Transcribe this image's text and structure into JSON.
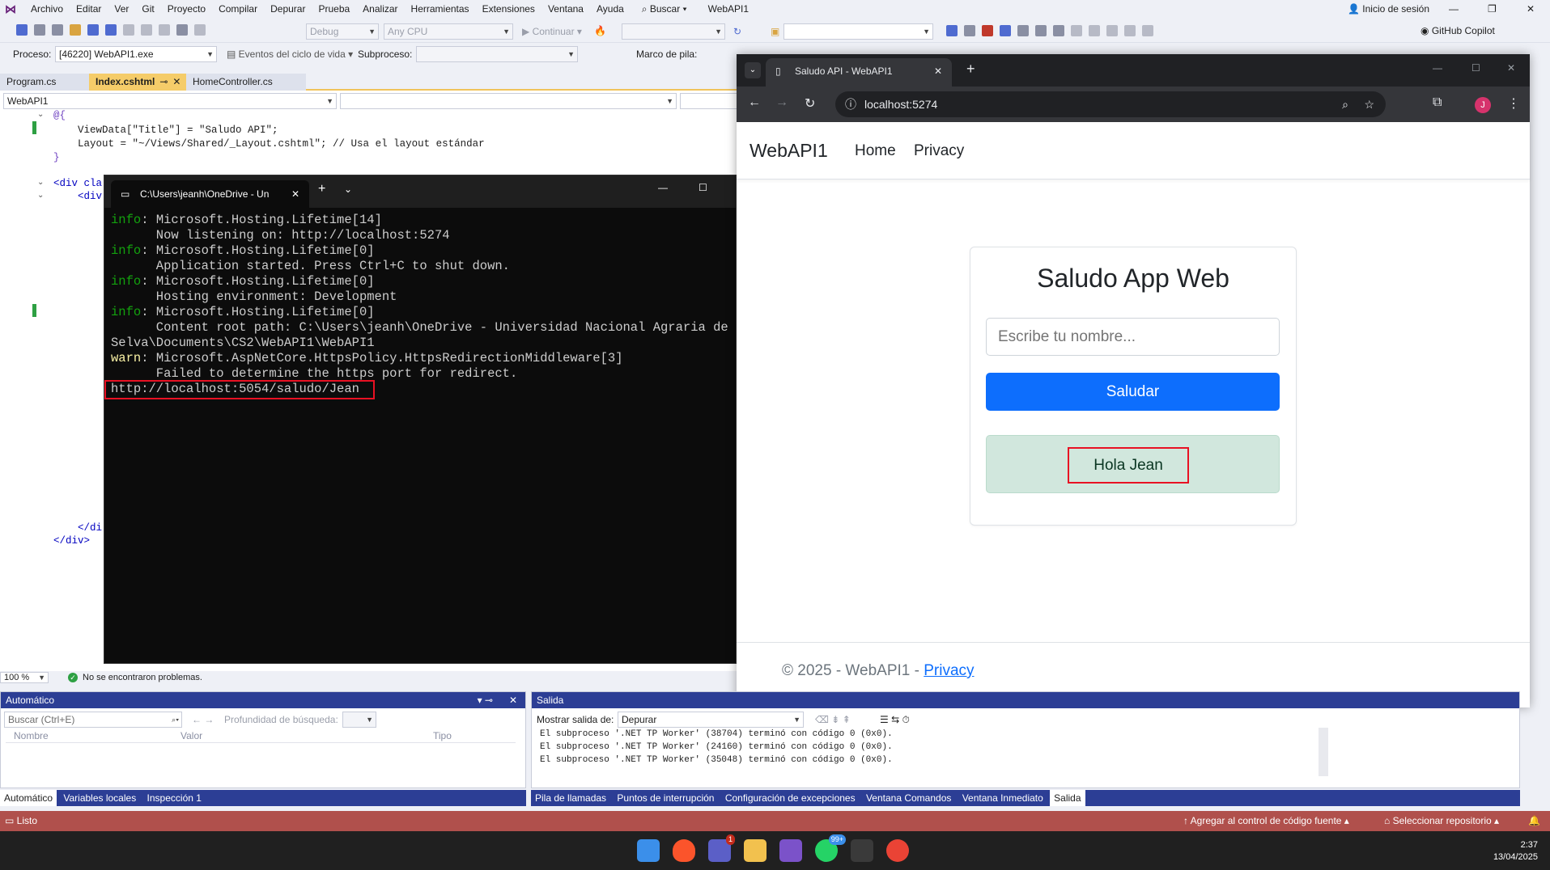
{
  "vs": {
    "menu": [
      "Archivo",
      "Editar",
      "Ver",
      "Git",
      "Proyecto",
      "Compilar",
      "Depurar",
      "Prueba",
      "Analizar",
      "Herramientas",
      "Extensiones",
      "Ventana",
      "Ayuda"
    ],
    "search_label": "Buscar",
    "solution_name": "WebAPI1",
    "signin": "Inicio de sesión",
    "config": "Debug",
    "platform": "Any CPU",
    "continue_label": "Continuar",
    "copilot": "GitHub Copilot",
    "process_label": "Proceso:",
    "process_value": "[46220] WebAPI1.exe",
    "lifecycle_label": "Eventos del ciclo de vida",
    "thread_label": "Subproceso:",
    "stackframe_label": "Marco de pila:",
    "tabs": [
      "Program.cs",
      "Index.cshtml",
      "HomeController.cs"
    ],
    "nav_project": "WebAPI1",
    "code": [
      "@{",
      "    ViewData[\"Title\"] = \"Saludo API\";",
      "    Layout = \"~/Views/Shared/_Layout.cshtml\"; // Usa el layout estándar",
      "}",
      "<div cla",
      "    <div",
      "    </di",
      "</div>"
    ],
    "zoom": "100 %",
    "issues": "No se encontraron problemas."
  },
  "terminal": {
    "tab_title": "C:\\Users\\jeanh\\OneDrive - Un",
    "lines": [
      {
        "tag": "info",
        "text": ": Microsoft.Hosting.Lifetime[14]"
      },
      {
        "tag": "",
        "text": "      Now listening on: http://localhost:5274"
      },
      {
        "tag": "info",
        "text": ": Microsoft.Hosting.Lifetime[0]"
      },
      {
        "tag": "",
        "text": "      Application started. Press Ctrl+C to shut down."
      },
      {
        "tag": "info",
        "text": ": Microsoft.Hosting.Lifetime[0]"
      },
      {
        "tag": "",
        "text": "      Hosting environment: Development"
      },
      {
        "tag": "info",
        "text": ": Microsoft.Hosting.Lifetime[0]"
      },
      {
        "tag": "",
        "text": "      Content root path: C:\\Users\\jeanh\\OneDrive - Universidad Nacional Agraria de la"
      },
      {
        "tag": "",
        "text": "Selva\\Documents\\CS2\\WebAPI1\\WebAPI1"
      },
      {
        "tag": "warn",
        "text": ": Microsoft.AspNetCore.HttpsPolicy.HttpsRedirectionMiddleware[3]"
      },
      {
        "tag": "",
        "text": "      Failed to determine the https port for redirect."
      },
      {
        "tag": "",
        "text": "http://localhost:5054/saludo/Jean"
      }
    ]
  },
  "browser": {
    "tab_title": "Saludo API - WebAPI1",
    "url": "localhost:5274",
    "profile_initial": "J",
    "brand": "WebAPI1",
    "nav": [
      "Home",
      "Privacy"
    ],
    "heading": "Saludo App Web",
    "input_placeholder": "Escribe tu nombre...",
    "button_label": "Saludar",
    "result": "Hola Jean",
    "footer_text": "© 2025 - WebAPI1 - ",
    "footer_link": "Privacy"
  },
  "auto_panel": {
    "title": "Automático",
    "search_placeholder": "Buscar (Ctrl+E)",
    "depth_label": "Profundidad de búsqueda:",
    "columns": [
      "Nombre",
      "Valor",
      "Tipo"
    ],
    "tabs": [
      "Automático",
      "Variables locales",
      "Inspección 1"
    ]
  },
  "output_panel": {
    "title": "Salida",
    "show_label": "Mostrar salida de:",
    "source": "Depurar",
    "lines": [
      "El subproceso '.NET TP Worker' (38704) terminó con código 0 (0x0).",
      "El subproceso '.NET TP Worker' (24160) terminó con código 0 (0x0).",
      "El subproceso '.NET TP Worker' (35048) terminó con código 0 (0x0)."
    ],
    "tabs": [
      "Pila de llamadas",
      "Puntos de interrupción",
      "Configuración de excepciones",
      "Ventana Comandos",
      "Ventana Inmediato",
      "Salida"
    ]
  },
  "status": {
    "ready": "Listo",
    "source_control": "Agregar al control de código fuente",
    "repo": "Seleccionar repositorio"
  },
  "taskbar": {
    "time": "2:37",
    "date": "13/04/2025",
    "teams_badge": "1",
    "whatsapp_badge": "99+"
  },
  "colors": {
    "vs_accent": "#2c3e95",
    "status_bar": "#b0504c",
    "primary_button": "#0d6efd",
    "alert_success_bg": "#d1e7dd",
    "highlight_box": "#e81123"
  }
}
